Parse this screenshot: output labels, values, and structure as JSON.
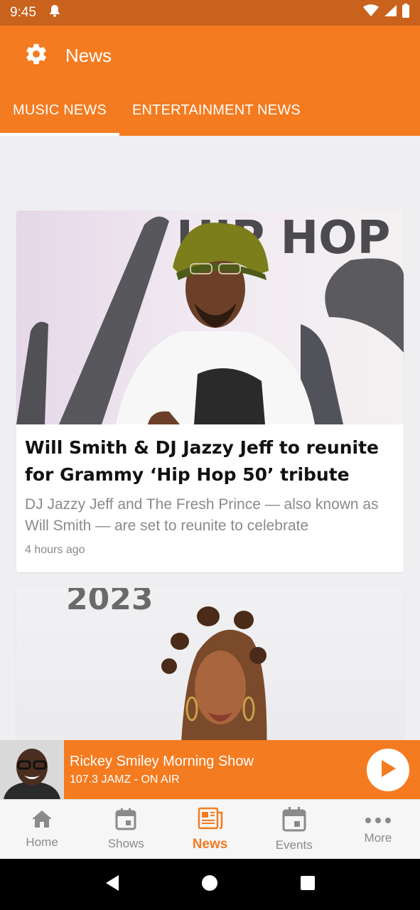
{
  "status_bar": {
    "time": "9:45"
  },
  "app_bar": {
    "title": "News"
  },
  "tabs": [
    {
      "label": "MUSIC NEWS",
      "active": true
    },
    {
      "label": "ENTERTAINMENT NEWS",
      "active": false
    }
  ],
  "articles": [
    {
      "title": "Will Smith & DJ Jazzy Jeff to reunite for Grammy ‘Hip Hop 50’ tribute",
      "description": "DJ Jazzy Jeff and The Fresh Prince — also known as Will Smith — are set to reunite to celebrate",
      "time": "4 hours ago",
      "image_text": "HIP HOP"
    },
    {
      "image_text": "2023"
    }
  ],
  "player": {
    "show": "Rickey Smiley Morning Show",
    "station": "107.3 JAMZ - ON AIR"
  },
  "bottom_nav": [
    {
      "label": "Home",
      "icon": "home-icon"
    },
    {
      "label": "Shows",
      "icon": "calendar-icon"
    },
    {
      "label": "News",
      "icon": "newspaper-icon",
      "active": true
    },
    {
      "label": "Events",
      "icon": "calendar-icon"
    },
    {
      "label": "More",
      "icon": "more-dots-icon"
    }
  ],
  "colors": {
    "brand": "#f47b20",
    "status_bar": "#c8621c"
  }
}
